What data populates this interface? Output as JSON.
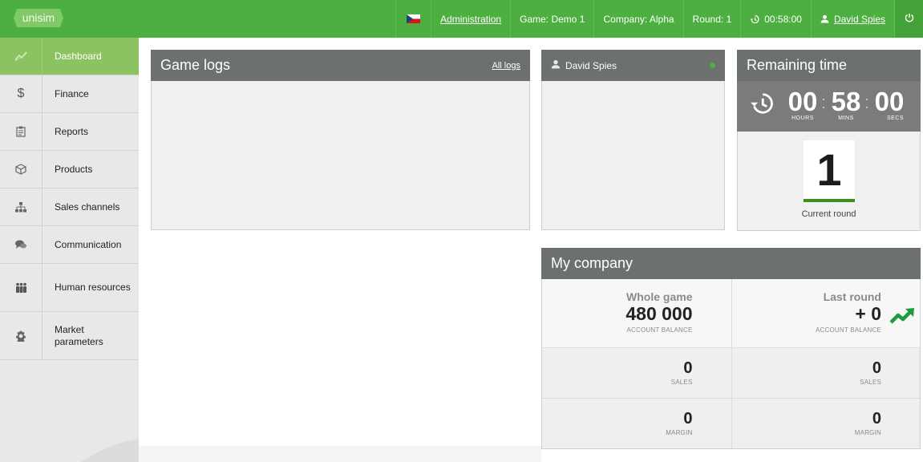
{
  "brand": {
    "logo_text": "unisim",
    "accent": "#4caf3f",
    "active": "#8cc361"
  },
  "topbar": {
    "language_flag": "czech-flag",
    "administration": "Administration",
    "game": "Game: Demo 1",
    "company": "Company: Alpha",
    "round": "Round: 1",
    "timer": "00:58:00",
    "user": "David Spies"
  },
  "sidebar": {
    "items": [
      {
        "label": "Dashboard",
        "icon": "trend-line-icon",
        "active": true
      },
      {
        "label": "Finance",
        "icon": "dollar-icon"
      },
      {
        "label": "Reports",
        "icon": "clipboard-icon"
      },
      {
        "label": "Products",
        "icon": "box-icon"
      },
      {
        "label": "Sales channels",
        "icon": "org-chart-icon"
      },
      {
        "label": "Communication",
        "icon": "chat-bubbles-icon"
      },
      {
        "label": "Human resources",
        "icon": "people-icon"
      },
      {
        "label": "Market parameters",
        "icon": "gear-icon"
      }
    ]
  },
  "game_logs": {
    "title": "Game logs",
    "all_logs": "All logs"
  },
  "user_panel": {
    "name": "David Spies"
  },
  "remaining_time": {
    "title": "Remaining time",
    "hours": "00",
    "mins": "58",
    "secs": "00",
    "hours_label": "HOURS",
    "mins_label": "MINS",
    "secs_label": "SECS",
    "current_round": "1",
    "current_round_label": "Current round"
  },
  "my_company": {
    "title": "My company",
    "whole_game": {
      "heading": "Whole game",
      "account_balance": "480 000",
      "account_balance_label": "ACCOUNT BALANCE",
      "sales": "0",
      "sales_label": "SALES",
      "margin": "0",
      "margin_label": "MARGIN"
    },
    "last_round": {
      "heading": "Last round",
      "account_balance": "+ 0",
      "account_balance_label": "ACCOUNT BALANCE",
      "trend": "trend-up-icon",
      "sales": "0",
      "sales_label": "SALES",
      "margin": "0",
      "margin_label": "MARGIN"
    }
  }
}
